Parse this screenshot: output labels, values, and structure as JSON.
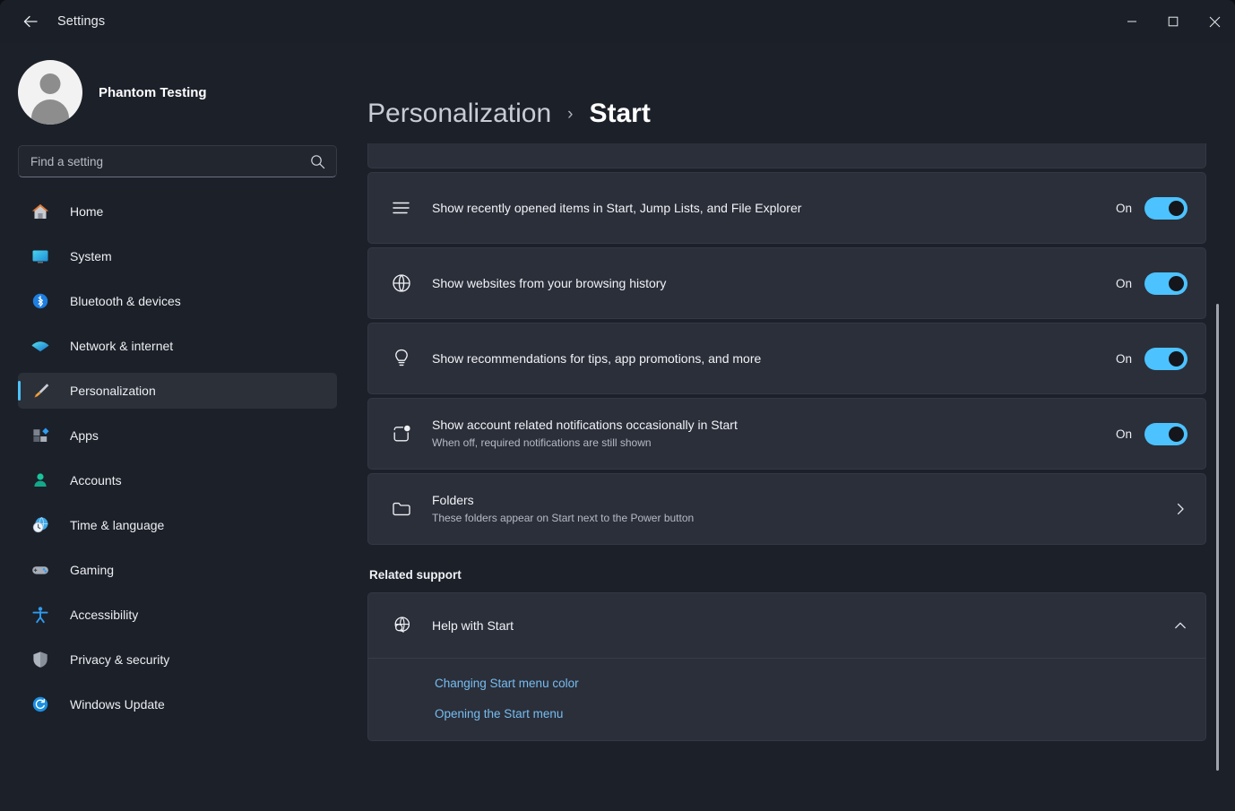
{
  "window": {
    "app_title": "Settings",
    "back_icon": "back-arrow-icon",
    "minimize_label": "Minimize",
    "maximize_label": "Maximize",
    "close_label": "Close"
  },
  "sidebar": {
    "profile_name": "Phantom Testing",
    "search": {
      "placeholder": "Find a setting",
      "value": "",
      "icon": "search-icon"
    },
    "items": [
      {
        "label": "Home",
        "icon": "home-icon",
        "active": false
      },
      {
        "label": "System",
        "icon": "system-monitor-icon",
        "active": false
      },
      {
        "label": "Bluetooth & devices",
        "icon": "bluetooth-icon",
        "active": false
      },
      {
        "label": "Network & internet",
        "icon": "wifi-icon",
        "active": false
      },
      {
        "label": "Personalization",
        "icon": "paintbrush-icon",
        "active": true
      },
      {
        "label": "Apps",
        "icon": "apps-icon",
        "active": false
      },
      {
        "label": "Accounts",
        "icon": "person-icon",
        "active": false
      },
      {
        "label": "Time & language",
        "icon": "clock-globe-icon",
        "active": false
      },
      {
        "label": "Gaming",
        "icon": "gamepad-icon",
        "active": false
      },
      {
        "label": "Accessibility",
        "icon": "accessibility-person-icon",
        "active": false
      },
      {
        "label": "Privacy & security",
        "icon": "shield-icon",
        "active": false
      },
      {
        "label": "Windows Update",
        "icon": "refresh-circle-icon",
        "active": false
      }
    ]
  },
  "header": {
    "breadcrumb_parent": "Personalization",
    "breadcrumb_separator": "›",
    "breadcrumb_current": "Start"
  },
  "main": {
    "settings": [
      {
        "icon": "list-lines-icon",
        "title": "Show recently opened items in Start, Jump Lists, and File Explorer",
        "subtitle": "",
        "control": "toggle",
        "state_label": "On",
        "state": true
      },
      {
        "icon": "globe-icon",
        "title": "Show websites from your browsing history",
        "subtitle": "",
        "control": "toggle",
        "state_label": "On",
        "state": true
      },
      {
        "icon": "lightbulb-icon",
        "title": "Show recommendations for tips, app promotions, and more",
        "subtitle": "",
        "control": "toggle",
        "state_label": "On",
        "state": true
      },
      {
        "icon": "notification-badge-icon",
        "title": "Show account related notifications occasionally in Start",
        "subtitle": "When off, required notifications are still shown",
        "control": "toggle",
        "state_label": "On",
        "state": true
      },
      {
        "icon": "folder-icon",
        "title": "Folders",
        "subtitle": "These folders appear on Start next to the Power button",
        "control": "chevron",
        "state_label": "",
        "state": null
      }
    ],
    "related_support": {
      "heading": "Related support",
      "help_icon": "globe-search-icon",
      "help_title": "Help with Start",
      "expanded": true,
      "collapse_icon": "chevron-up-icon",
      "links": [
        "Changing Start menu color",
        "Opening the Start menu"
      ]
    }
  },
  "colors": {
    "accent": "#4cc2ff",
    "link": "#76bdf0",
    "card_bg": "#2b2f3a",
    "page_bg": "#1c2029"
  },
  "scroll": {
    "thumb_top_pct": 24,
    "thumb_height_pct": 70
  }
}
